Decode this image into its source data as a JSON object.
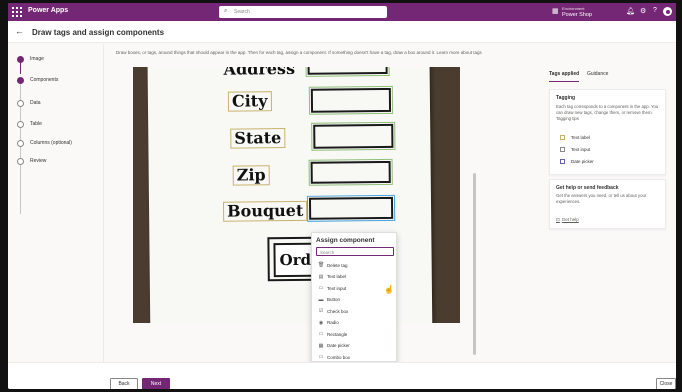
{
  "topbar": {
    "app_name": "Power Apps",
    "search_placeholder": "Search",
    "environment_label": "Environment",
    "environment_name": "Power Shop",
    "accent": "#742774"
  },
  "header": {
    "title": "Draw tags and assign components"
  },
  "steps": [
    {
      "label": "Image",
      "state": "done"
    },
    {
      "label": "Components",
      "state": "current"
    },
    {
      "label": "Data",
      "state": "todo"
    },
    {
      "label": "Table",
      "state": "todo"
    },
    {
      "label": "Columns (optional)",
      "state": "todo"
    },
    {
      "label": "Review",
      "state": "todo"
    }
  ],
  "instruction": "Draw boxes, or tags, around things that should appear in the app. Then for each tag, assign a component. If something doesn't have a tag, draw a box around it. Learn more about tags",
  "sketch": {
    "words": [
      "Address",
      "City",
      "State",
      "Zip",
      "Bouquet",
      "Order h"
    ]
  },
  "assign": {
    "title": "Assign component",
    "search_placeholder": "Search",
    "items": [
      {
        "icon": "trash-icon",
        "label": "Delete tag"
      },
      {
        "icon": "text-label-icon",
        "label": "Text label"
      },
      {
        "icon": "text-input-icon",
        "label": "Text input"
      },
      {
        "icon": "button-icon",
        "label": "Button"
      },
      {
        "icon": "checkbox-icon",
        "label": "Check box"
      },
      {
        "icon": "radio-icon",
        "label": "Radio"
      },
      {
        "icon": "rectangle-icon",
        "label": "Rectangle"
      },
      {
        "icon": "date-picker-icon",
        "label": "Date picker"
      },
      {
        "icon": "combo-box-icon",
        "label": "Combo box"
      }
    ]
  },
  "right_panel": {
    "tabs": [
      "Tags applied",
      "Guidance"
    ],
    "tagging": {
      "title": "Tagging",
      "description": "Each tag corresponds to a component in the app. You can draw new tags, change them, or remove them. Tagging tips",
      "legend": [
        {
          "label": "Text label",
          "color": "#c8b36e"
        },
        {
          "label": "Text input",
          "color": "#8a8886"
        },
        {
          "label": "Date picker",
          "color": "#6264a7"
        }
      ]
    },
    "help": {
      "title": "Get help or send feedback",
      "description": "Get the answers you need, or tell us about your experiences.",
      "link": "Get help"
    }
  },
  "footer": {
    "back_label": "Back",
    "next_label": "Next",
    "close_label": "Close"
  }
}
